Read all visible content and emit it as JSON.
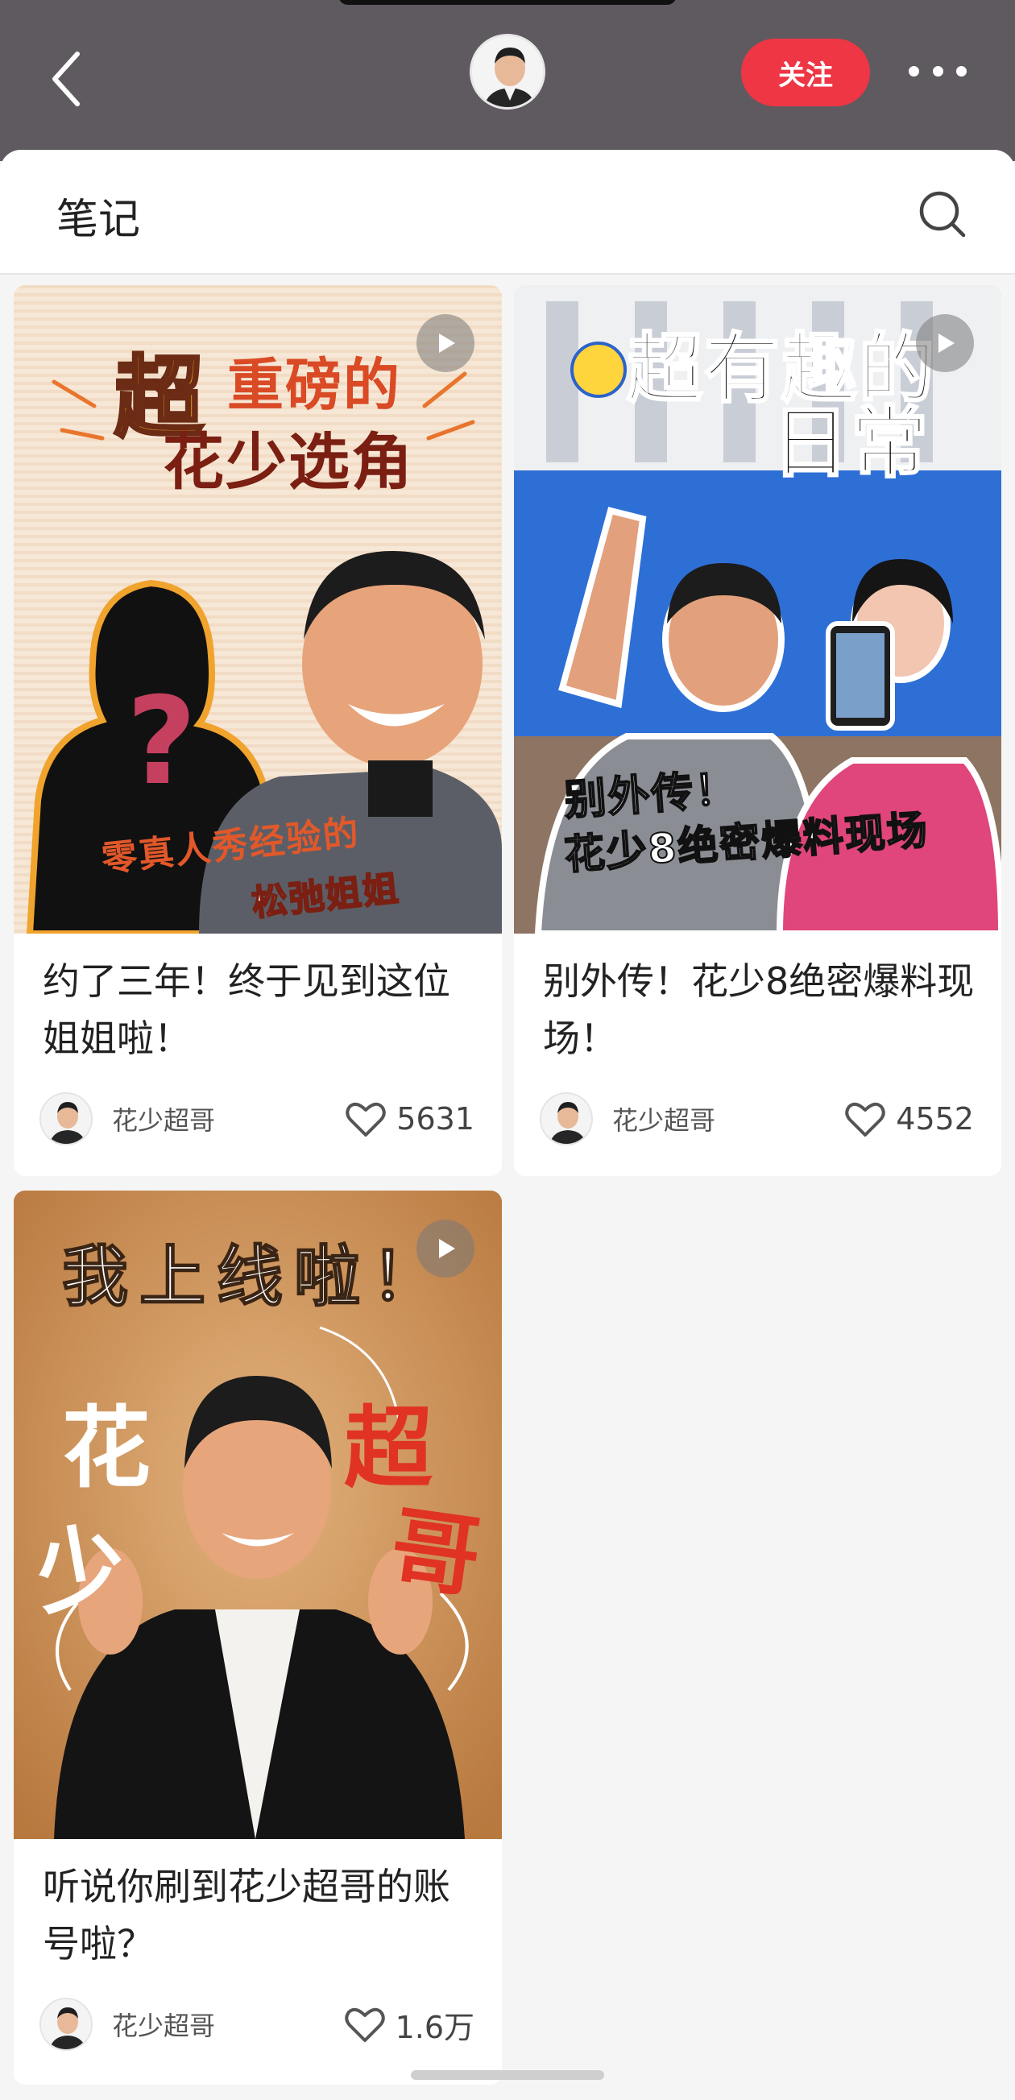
{
  "header": {
    "follow_label": "关注"
  },
  "section": {
    "title": "笔记"
  },
  "notes": [
    {
      "title": "约了三年！终于见到这位姐姐啦！",
      "author": "花少超哥",
      "likes": "5631",
      "cover_text": {
        "headline_a": "超",
        "headline_b": "重磅的",
        "headline_c": "花少选角",
        "caption_a": "零真人秀经验的",
        "caption_b": "松弛姐姐",
        "mark": "?"
      }
    },
    {
      "title": "别外传！花少8绝密爆料现场！",
      "author": "花少超哥",
      "likes": "4552",
      "cover_text": {
        "headline_a": "超有趣的",
        "headline_b": "日常",
        "caption_a": "别外传！",
        "caption_b": "花少8绝密爆料现场"
      }
    },
    {
      "title": "听说你刷到花少超哥的账号啦？",
      "author": "花少超哥",
      "likes": "1.6万",
      "cover_text": {
        "headline": "我上线啦！",
        "name_a": "花",
        "name_b": "少",
        "name_c": "超",
        "name_d": "哥"
      }
    }
  ],
  "colors": {
    "header_bg": "#5f5a60",
    "follow_bg": "#ee3645",
    "page_bg": "#f5f5f5"
  }
}
